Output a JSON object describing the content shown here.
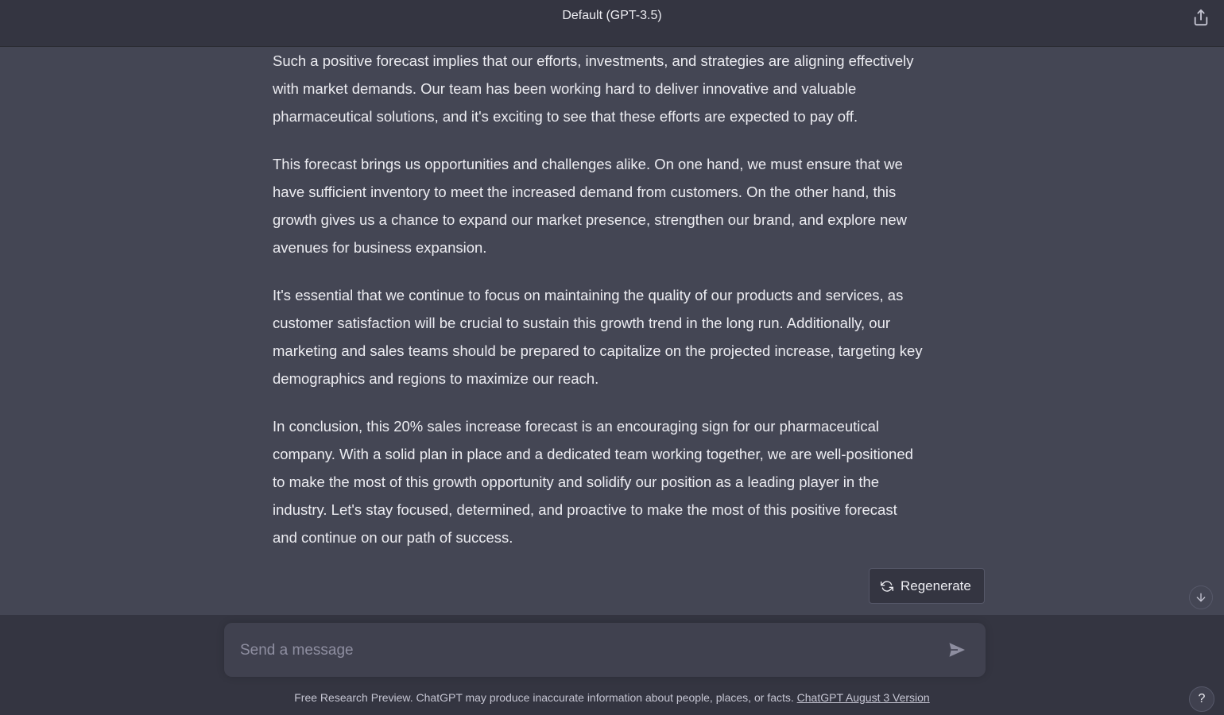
{
  "header": {
    "title": "Default (GPT-3.5)",
    "share_icon": "share-icon"
  },
  "message": {
    "paragraphs": [
      "Such a positive forecast implies that our efforts, investments, and strategies are aligning effectively with market demands. Our team has been working hard to deliver innovative and valuable pharmaceutical solutions, and it's exciting to see that these efforts are expected to pay off.",
      "This forecast brings us opportunities and challenges alike. On one hand, we must ensure that we have sufficient inventory to meet the increased demand from customers. On the other hand, this growth gives us a chance to expand our market presence, strengthen our brand, and explore new avenues for business expansion.",
      "It's essential that we continue to focus on maintaining the quality of our products and services, as customer satisfaction will be crucial to sustain this growth trend in the long run. Additionally, our marketing and sales teams should be prepared to capitalize on the projected increase, targeting key demographics and regions to maximize our reach.",
      "In conclusion, this 20% sales increase forecast is an encouraging sign for our pharmaceutical company. With a solid plan in place and a dedicated team working together, we are well-positioned to make the most of this growth opportunity and solidify our position as a leading player in the industry. Let's stay focused, determined, and proactive to make the most of this positive forecast and continue on our path of success."
    ]
  },
  "actions": {
    "regenerate_label": "Regenerate",
    "scroll_down_icon": "arrow-down-icon"
  },
  "composer": {
    "placeholder": "Send a message",
    "value": "",
    "send_icon": "send-icon"
  },
  "footer": {
    "note": "Free Research Preview. ChatGPT may produce inaccurate information about people, places, or facts.",
    "link_label": "ChatGPT August 3 Version",
    "help_label": "?"
  },
  "colors": {
    "background": "#444654",
    "header": "#343541",
    "input": "#40414f",
    "text": "#ececf1"
  }
}
